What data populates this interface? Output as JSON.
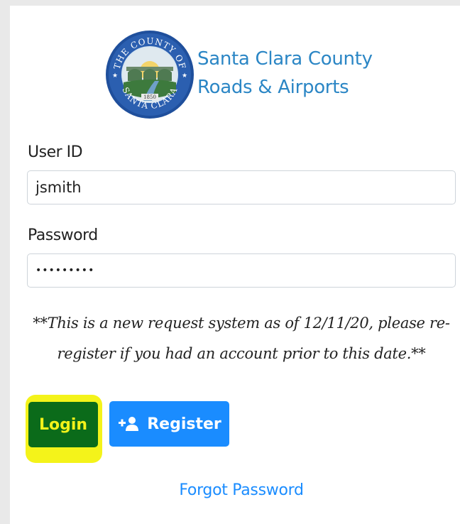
{
  "brand": {
    "line1": "Santa Clara County",
    "line2": "Roads & Airports",
    "seal_top_text": "THE COUNTY OF",
    "seal_bottom_text": "SANTA CLARA",
    "seal_year": "1850"
  },
  "form": {
    "user_id_label": "User ID",
    "user_id_value": "jsmith",
    "password_label": "Password",
    "password_value": "•••••••••"
  },
  "notice": {
    "line1": "**This is a new request system as of 12/11/20, please re-",
    "line2": "register if you had an account prior to this date.**"
  },
  "buttons": {
    "login": "Login",
    "register": "Register",
    "register_icon": "add-user-icon"
  },
  "links": {
    "forgot_password": "Forgot Password"
  },
  "colors": {
    "brand_blue": "#2b86c5",
    "login_bg": "#0b6b1a",
    "login_text": "#f2f21a",
    "highlight": "#f4f31a",
    "register_bg": "#1a8cff",
    "link": "#1a8cff"
  }
}
